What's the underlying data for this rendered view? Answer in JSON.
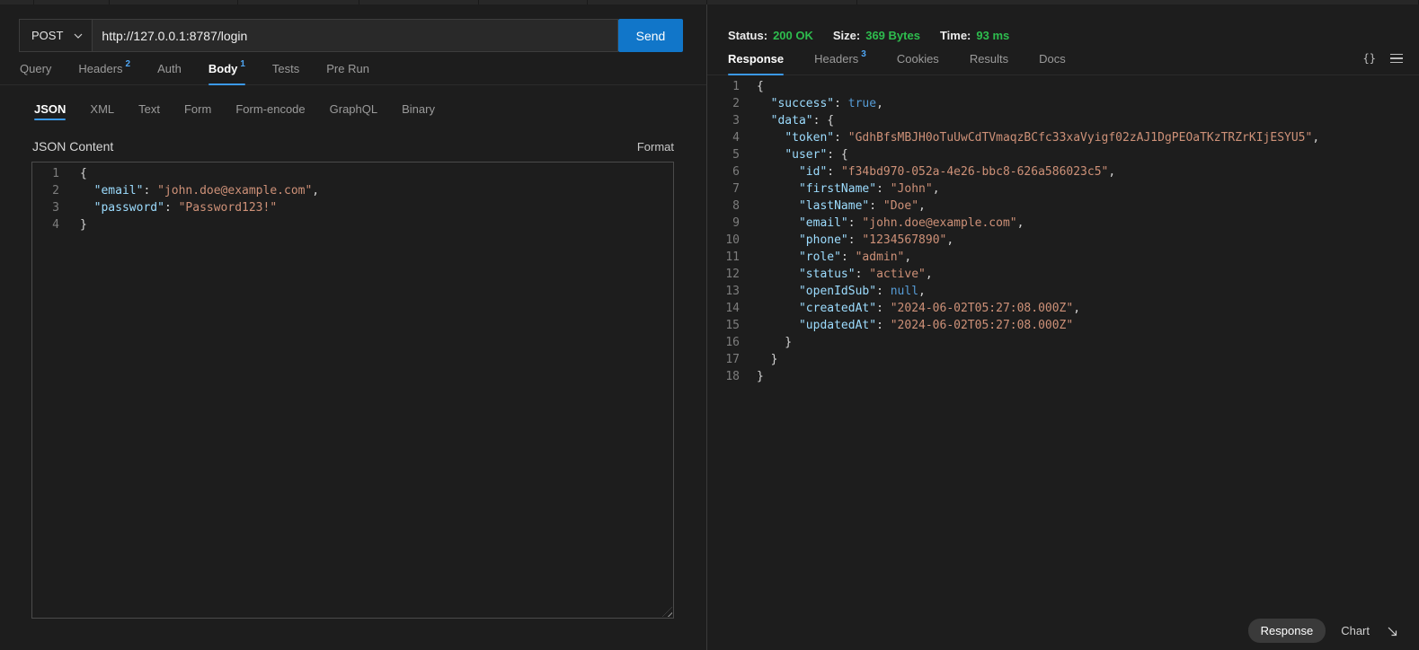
{
  "colors": {
    "accent_blue": "#1176c9",
    "tab_underline": "#3b99e8",
    "badge_blue": "#4fa6f3",
    "success_green": "#2ebd4e",
    "json_key": "#9cdcfe",
    "json_string": "#ce9178",
    "json_keyword": "#569cd6"
  },
  "request": {
    "method": "POST",
    "url": "http://127.0.0.1:8787/login",
    "send_label": "Send",
    "tabs": [
      {
        "label": "Query"
      },
      {
        "label": "Headers",
        "badge": "2"
      },
      {
        "label": "Auth"
      },
      {
        "label": "Body",
        "badge": "1"
      },
      {
        "label": "Tests"
      },
      {
        "label": "Pre Run"
      }
    ],
    "body_tabs": [
      "JSON",
      "XML",
      "Text",
      "Form",
      "Form-encode",
      "GraphQL",
      "Binary"
    ],
    "content_label": "JSON Content",
    "format_label": "Format"
  },
  "request_code": {
    "lines": [
      [
        {
          "t": "p",
          "v": "{"
        }
      ],
      [
        {
          "t": "p",
          "v": "  "
        },
        {
          "t": "k",
          "v": "\"email\""
        },
        {
          "t": "p",
          "v": ": "
        },
        {
          "t": "s",
          "v": "\"john.doe@example.com\""
        },
        {
          "t": "p",
          "v": ","
        }
      ],
      [
        {
          "t": "p",
          "v": "  "
        },
        {
          "t": "k",
          "v": "\"password\""
        },
        {
          "t": "p",
          "v": ": "
        },
        {
          "t": "s",
          "v": "\"Password123!\""
        }
      ],
      [
        {
          "t": "p",
          "v": "}"
        }
      ]
    ]
  },
  "response": {
    "meta": [
      {
        "label": "Status:",
        "value": "200 OK"
      },
      {
        "label": "Size:",
        "value": "369 Bytes"
      },
      {
        "label": "Time:",
        "value": "93 ms"
      }
    ],
    "tabs": [
      {
        "label": "Response"
      },
      {
        "label": "Headers",
        "badge": "3"
      },
      {
        "label": "Cookies"
      },
      {
        "label": "Results"
      },
      {
        "label": "Docs"
      }
    ],
    "braces_icon": "{}",
    "overlay": {
      "response_label": "Response",
      "chart_label": "Chart"
    }
  },
  "response_code": {
    "lines": [
      [
        {
          "t": "p",
          "v": "{"
        }
      ],
      [
        {
          "t": "p",
          "v": "  "
        },
        {
          "t": "k",
          "v": "\"success\""
        },
        {
          "t": "p",
          "v": ": "
        },
        {
          "t": "b",
          "v": "true"
        },
        {
          "t": "p",
          "v": ","
        }
      ],
      [
        {
          "t": "p",
          "v": "  "
        },
        {
          "t": "k",
          "v": "\"data\""
        },
        {
          "t": "p",
          "v": ": {"
        }
      ],
      [
        {
          "t": "p",
          "v": "    "
        },
        {
          "t": "k",
          "v": "\"token\""
        },
        {
          "t": "p",
          "v": ": "
        },
        {
          "t": "s",
          "v": "\"GdhBfsMBJH0oTuUwCdTVmaqzBCfc33xaVyigf02zAJ1DgPEOaTKzTRZrKIjESYU5\""
        },
        {
          "t": "p",
          "v": ","
        }
      ],
      [
        {
          "t": "p",
          "v": "    "
        },
        {
          "t": "k",
          "v": "\"user\""
        },
        {
          "t": "p",
          "v": ": {"
        }
      ],
      [
        {
          "t": "p",
          "v": "      "
        },
        {
          "t": "k",
          "v": "\"id\""
        },
        {
          "t": "p",
          "v": ": "
        },
        {
          "t": "s",
          "v": "\"f34bd970-052a-4e26-bbc8-626a586023c5\""
        },
        {
          "t": "p",
          "v": ","
        }
      ],
      [
        {
          "t": "p",
          "v": "      "
        },
        {
          "t": "k",
          "v": "\"firstName\""
        },
        {
          "t": "p",
          "v": ": "
        },
        {
          "t": "s",
          "v": "\"John\""
        },
        {
          "t": "p",
          "v": ","
        }
      ],
      [
        {
          "t": "p",
          "v": "      "
        },
        {
          "t": "k",
          "v": "\"lastName\""
        },
        {
          "t": "p",
          "v": ": "
        },
        {
          "t": "s",
          "v": "\"Doe\""
        },
        {
          "t": "p",
          "v": ","
        }
      ],
      [
        {
          "t": "p",
          "v": "      "
        },
        {
          "t": "k",
          "v": "\"email\""
        },
        {
          "t": "p",
          "v": ": "
        },
        {
          "t": "s",
          "v": "\"john.doe@example.com\""
        },
        {
          "t": "p",
          "v": ","
        }
      ],
      [
        {
          "t": "p",
          "v": "      "
        },
        {
          "t": "k",
          "v": "\"phone\""
        },
        {
          "t": "p",
          "v": ": "
        },
        {
          "t": "s",
          "v": "\"1234567890\""
        },
        {
          "t": "p",
          "v": ","
        }
      ],
      [
        {
          "t": "p",
          "v": "      "
        },
        {
          "t": "k",
          "v": "\"role\""
        },
        {
          "t": "p",
          "v": ": "
        },
        {
          "t": "s",
          "v": "\"admin\""
        },
        {
          "t": "p",
          "v": ","
        }
      ],
      [
        {
          "t": "p",
          "v": "      "
        },
        {
          "t": "k",
          "v": "\"status\""
        },
        {
          "t": "p",
          "v": ": "
        },
        {
          "t": "s",
          "v": "\"active\""
        },
        {
          "t": "p",
          "v": ","
        }
      ],
      [
        {
          "t": "p",
          "v": "      "
        },
        {
          "t": "k",
          "v": "\"openIdSub\""
        },
        {
          "t": "p",
          "v": ": "
        },
        {
          "t": "b",
          "v": "null"
        },
        {
          "t": "p",
          "v": ","
        }
      ],
      [
        {
          "t": "p",
          "v": "      "
        },
        {
          "t": "k",
          "v": "\"createdAt\""
        },
        {
          "t": "p",
          "v": ": "
        },
        {
          "t": "s",
          "v": "\"2024-06-02T05:27:08.000Z\""
        },
        {
          "t": "p",
          "v": ","
        }
      ],
      [
        {
          "t": "p",
          "v": "      "
        },
        {
          "t": "k",
          "v": "\"updatedAt\""
        },
        {
          "t": "p",
          "v": ": "
        },
        {
          "t": "s",
          "v": "\"2024-06-02T05:27:08.000Z\""
        }
      ],
      [
        {
          "t": "p",
          "v": "    }"
        }
      ],
      [
        {
          "t": "p",
          "v": "  }"
        }
      ],
      [
        {
          "t": "p",
          "v": "}"
        }
      ]
    ]
  }
}
